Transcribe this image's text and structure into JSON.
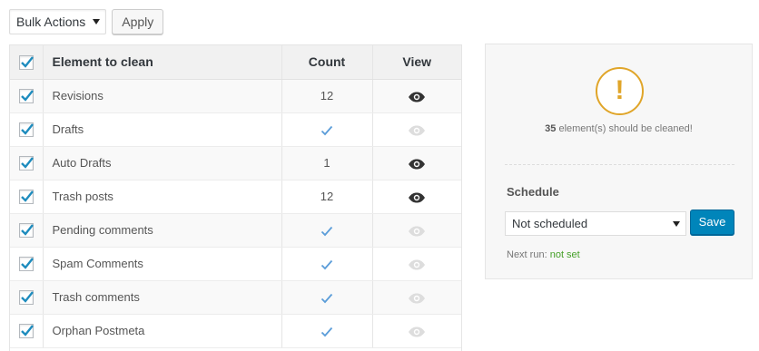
{
  "toolbar": {
    "bulk_select_value": "Bulk Actions",
    "apply_label": "Apply"
  },
  "table": {
    "headers": {
      "element": "Element to clean",
      "count": "Count",
      "view": "View"
    },
    "rows": [
      {
        "label": "Revisions",
        "count": "12",
        "has_count": true,
        "view_active": true
      },
      {
        "label": "Drafts",
        "count": "",
        "has_count": false,
        "view_active": false
      },
      {
        "label": "Auto Drafts",
        "count": "1",
        "has_count": true,
        "view_active": true
      },
      {
        "label": "Trash posts",
        "count": "12",
        "has_count": true,
        "view_active": true
      },
      {
        "label": "Pending comments",
        "count": "",
        "has_count": false,
        "view_active": false
      },
      {
        "label": "Spam Comments",
        "count": "",
        "has_count": false,
        "view_active": false
      },
      {
        "label": "Trash comments",
        "count": "",
        "has_count": false,
        "view_active": false
      },
      {
        "label": "Orphan Postmeta",
        "count": "",
        "has_count": false,
        "view_active": false
      }
    ]
  },
  "panel": {
    "alert_symbol": "!",
    "total_count": "35",
    "summary_text": "element(s) should be cleaned!",
    "schedule_title": "Schedule",
    "schedule_value": "Not scheduled",
    "save_label": "Save",
    "next_run_label": "Next run:",
    "next_run_value": "not set"
  },
  "colors": {
    "accent_blue": "#0085ba",
    "check_blue": "#1e8cbe",
    "alert_orange": "#e0a529",
    "ok_green": "#46a029",
    "eye_active": "#333333",
    "eye_inactive": "#dddddd"
  },
  "icons": {
    "checkbox": "checkmark-icon",
    "no_items": "check-icon",
    "view": "eye-icon",
    "alert": "exclamation-icon"
  }
}
